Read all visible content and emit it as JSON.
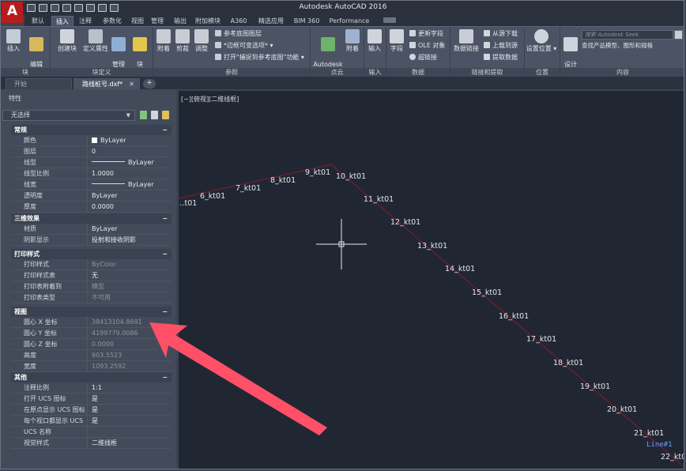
{
  "app": {
    "title": "Autodesk AutoCAD 2016",
    "logo": "A"
  },
  "ribbon_tabs": [
    "默认",
    "插入",
    "注释",
    "参数化",
    "视图",
    "管理",
    "输出",
    "附加模块",
    "A360",
    "精选应用",
    "BIM 360",
    "Performance"
  ],
  "ribbon_active_tab": "插入",
  "ribbon": {
    "block": {
      "insert": "插入",
      "edit_attr": "编辑\n属性",
      "group": "块"
    },
    "block_def": {
      "create": "创建块",
      "define_attr": "定义属性",
      "manage_attr": "管理\n属性",
      "block_editor": "块\n编辑器",
      "group": "块定义"
    },
    "reference": {
      "attach": "附着",
      "clip": "剪裁",
      "adjust": "调整",
      "underlay_layers": "参考底图图层",
      "frame_vary": "*边框可变选项*",
      "snap_underlay": "打开\"捕捉到参考底图\"功能",
      "group": "参照"
    },
    "pointcloud": {
      "recap": "Autodesk\nReCap",
      "attach": "附着",
      "group": "点云"
    },
    "import": {
      "import": "输入",
      "group": "输入"
    },
    "data": {
      "field": "字段",
      "update_fields": "更新字段",
      "ole": "OLE 对象",
      "hyperlink": "超链接",
      "group": "数据"
    },
    "linking": {
      "data_link": "数据链接",
      "download": "从源下载",
      "upload": "上载到源",
      "extract": "提取数据",
      "group": "链接和提取"
    },
    "location": {
      "set_location": "设置位置",
      "group": "位置"
    },
    "content": {
      "design_center": "设计\n中心",
      "seek_placeholder": "搜索 Autodesk Seek",
      "seek_desc": "查找产品模型、图形和规格",
      "group": "内容"
    }
  },
  "doc_tabs": [
    {
      "label": "开始",
      "active": false
    },
    {
      "label": "路线桩号.dxf*",
      "active": true
    }
  ],
  "properties": {
    "title": "特性",
    "selection": "无选择",
    "sections": [
      {
        "name": "常规",
        "rows": [
          {
            "k": "颜色",
            "v": "ByLayer",
            "kind": "color"
          },
          {
            "k": "图层",
            "v": "0"
          },
          {
            "k": "线型",
            "v": "ByLayer",
            "kind": "line"
          },
          {
            "k": "线型比例",
            "v": "1.0000"
          },
          {
            "k": "线宽",
            "v": "ByLayer",
            "kind": "line"
          },
          {
            "k": "透明度",
            "v": "ByLayer"
          },
          {
            "k": "厚度",
            "v": "0.0000"
          }
        ]
      },
      {
        "name": "三维效果",
        "rows": [
          {
            "k": "材质",
            "v": "ByLayer"
          },
          {
            "k": "阴影显示",
            "v": "投射和接收阴影"
          }
        ]
      },
      {
        "name": "打印样式",
        "rows": [
          {
            "k": "打印样式",
            "v": "ByColor",
            "dim": true
          },
          {
            "k": "打印样式表",
            "v": "无"
          },
          {
            "k": "打印表附着到",
            "v": "模型",
            "dim": true
          },
          {
            "k": "打印表类型",
            "v": "不可用",
            "dim": true
          }
        ]
      },
      {
        "name": "视图",
        "rows": [
          {
            "k": "圆心 X 坐标",
            "v": "38413104.8691",
            "dim": true
          },
          {
            "k": "圆心 Y 坐标",
            "v": "4199779.0086",
            "dim": true
          },
          {
            "k": "圆心 Z 坐标",
            "v": "0.0000",
            "dim": true
          },
          {
            "k": "高度",
            "v": "603.5523",
            "dim": true
          },
          {
            "k": "宽度",
            "v": "1093.2592",
            "dim": true
          }
        ]
      },
      {
        "name": "其他",
        "rows": [
          {
            "k": "注释比例",
            "v": "1:1"
          },
          {
            "k": "打开 UCS 图标",
            "v": "是"
          },
          {
            "k": "在原点显示 UCS 图标",
            "v": "是"
          },
          {
            "k": "每个视口都显示 UCS",
            "v": "是"
          },
          {
            "k": "UCS 名称",
            "v": ""
          },
          {
            "k": "视觉样式",
            "v": "二维线框"
          }
        ]
      }
    ]
  },
  "viewport": {
    "label": "[−][俯视][二维线框]",
    "line_label": "Line#1",
    "stations": [
      "…t01",
      "6_kt01",
      "7_kt01",
      "8_kt01",
      "9_kt01",
      "10_kt01",
      "11_kt01",
      "12_kt01",
      "13_kt01",
      "14_kt01",
      "15_kt01",
      "16_kt01",
      "17_kt01",
      "18_kt01",
      "19_kt01",
      "20_kt01",
      "21_kt01",
      "22_kt01"
    ]
  },
  "colors": {
    "accent_tab": "#4a5466",
    "canvas_bg": "#202733",
    "route_line": "#8b1a2a",
    "annotation_arrow": "#ff4f6a",
    "line_label": "#6aa0ff"
  }
}
